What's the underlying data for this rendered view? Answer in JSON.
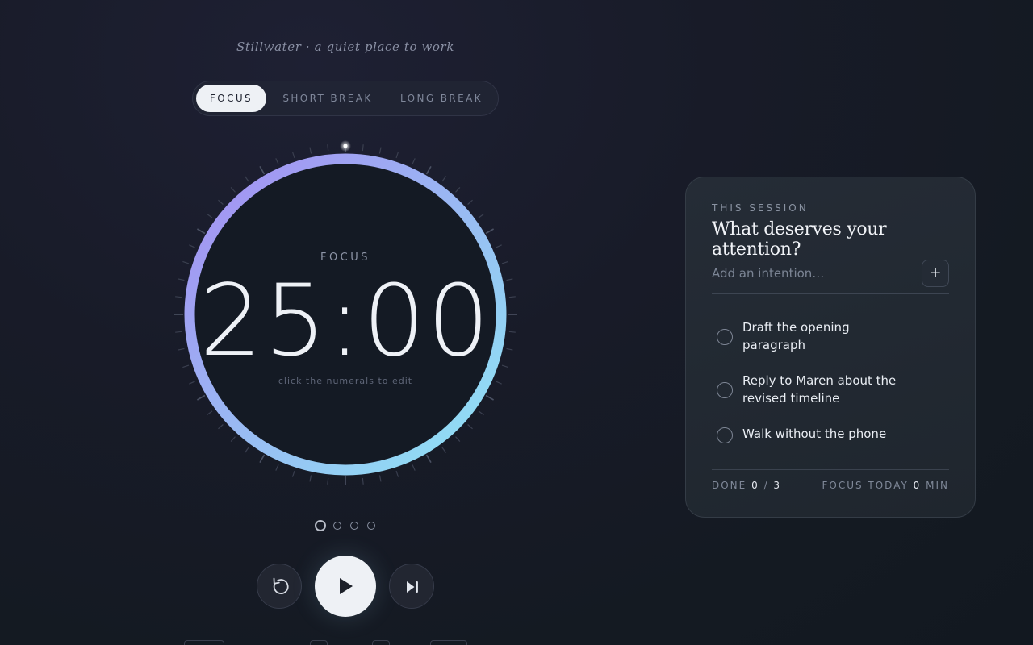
{
  "app": {
    "tagline": "Stillwater · a quiet place to work"
  },
  "modes": {
    "tabs": [
      {
        "label": "FOCUS",
        "active": true
      },
      {
        "label": "SHORT BREAK",
        "active": false
      },
      {
        "label": "LONG BREAK",
        "active": false
      }
    ]
  },
  "timer": {
    "mode_label": "FOCUS",
    "time": "25:00",
    "edit_hint": "click the numerals to edit",
    "progress": 1.0,
    "ring_colors": {
      "start": "#8ee6f4",
      "end": "#a58cf2"
    }
  },
  "sessions": {
    "total": 4,
    "current": 1
  },
  "controls": {
    "reset_icon": "reset-icon",
    "play_icon": "play-icon",
    "skip_icon": "skip-icon"
  },
  "card": {
    "eyebrow": "THIS SESSION",
    "title": "What deserves your attention?",
    "input_placeholder": "Add an intention…",
    "add_label": "+",
    "tasks": [
      {
        "text": "Draft the opening paragraph",
        "done": false
      },
      {
        "text": "Reply to Maren about the revised timeline",
        "done": false
      },
      {
        "text": "Walk without the phone",
        "done": false
      }
    ],
    "footer": {
      "done_label": "DONE",
      "done_count": "0",
      "separator": "/",
      "done_total": "3",
      "focus_label": "FOCUS TODAY",
      "focus_minutes": "0",
      "focus_unit": "MIN"
    }
  }
}
